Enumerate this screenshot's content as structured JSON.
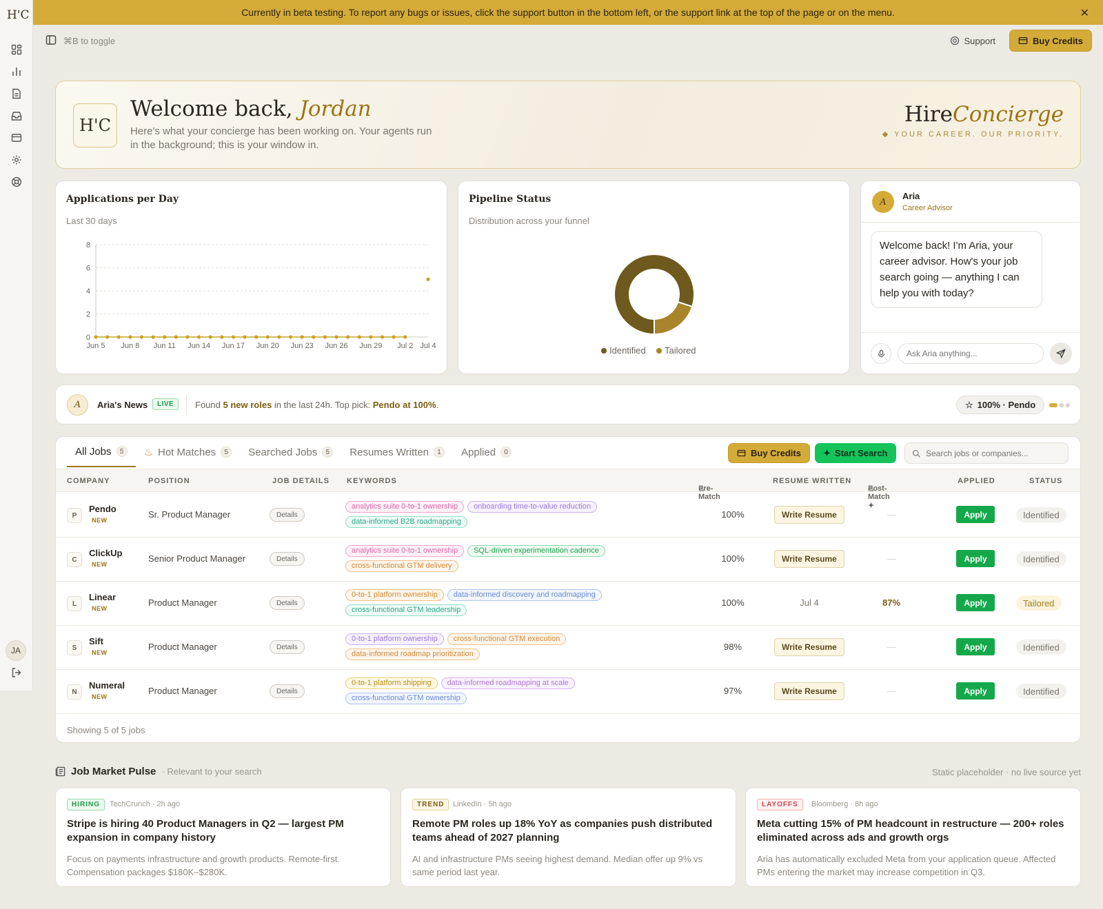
{
  "banner": {
    "text": "Currently in beta testing. To report any bugs or issues, click the support button in the bottom left, or the support link at the top of the page or on the menu."
  },
  "sidebar": {
    "logo": "H'C",
    "avatar": "JA"
  },
  "topbar": {
    "toggle_hint": "⌘B to toggle",
    "support": "Support",
    "buy_credits": "Buy Credits"
  },
  "hero": {
    "monogram": "H'C",
    "greeting": "Welcome back,",
    "name": "Jordan",
    "subtitle": "Here's what your concierge has been working on. Your agents run in the background; this is your window in.",
    "brand_a": "Hire",
    "brand_b": "Concierge",
    "tagline": "◆ YOUR CAREER. OUR PRIORITY."
  },
  "apps_chart": {
    "title": "Applications per Day",
    "subtitle": "Last 30 days",
    "chart_data": {
      "type": "line",
      "x": [
        "Jun 5",
        "Jun 6",
        "Jun 7",
        "Jun 8",
        "Jun 9",
        "Jun 10",
        "Jun 11",
        "Jun 12",
        "Jun 13",
        "Jun 14",
        "Jun 15",
        "Jun 16",
        "Jun 17",
        "Jun 18",
        "Jun 19",
        "Jun 20",
        "Jun 21",
        "Jun 22",
        "Jun 23",
        "Jun 24",
        "Jun 25",
        "Jun 26",
        "Jun 27",
        "Jun 28",
        "Jun 29",
        "Jun 30",
        "Jul 1",
        "Jul 2",
        "Jul 3",
        "Jul 4"
      ],
      "values": [
        0,
        0,
        0,
        0,
        0,
        0,
        0,
        0,
        0,
        0,
        0,
        0,
        0,
        0,
        0,
        0,
        0,
        0,
        0,
        0,
        0,
        0,
        0,
        0,
        0,
        0,
        0,
        0,
        null,
        5
      ],
      "xticks": [
        "Jun 5",
        "Jun 8",
        "Jun 11",
        "Jun 14",
        "Jun 17",
        "Jun 20",
        "Jun 23",
        "Jun 26",
        "Jun 29",
        "Jul 2",
        "Jul 4"
      ],
      "yticks": [
        0,
        2,
        4,
        6,
        8
      ],
      "ylim": [
        0,
        8
      ],
      "grid": true,
      "color": "#c9a227"
    }
  },
  "pipeline": {
    "title": "Pipeline Status",
    "subtitle": "Distribution across your funnel",
    "chart_data": {
      "type": "pie",
      "labels": [
        "Identified",
        "Tailored"
      ],
      "values": [
        4,
        1
      ],
      "colors": [
        "#6e5a1e",
        "#a8852a"
      ],
      "legend": "bottom"
    }
  },
  "aria": {
    "initial": "A",
    "name": "Aria",
    "role": "Career Advisor",
    "message": "Welcome back! I'm Aria, your career advisor. How's your job search going — anything I can help you with today?",
    "input_placeholder": "Ask Aria anything..."
  },
  "news": {
    "initial": "A",
    "label": "Aria's News",
    "live": "LIVE",
    "pre": "Found ",
    "count": "5 new roles",
    "mid": " in the last 24h. Top pick: ",
    "pick": "Pendo at 100%",
    "post": ".",
    "chip": "100% · Pendo"
  },
  "jobs": {
    "tabs": [
      {
        "label": "All Jobs",
        "count": "5"
      },
      {
        "label": "Hot Matches",
        "count": "5"
      },
      {
        "label": "Searched Jobs",
        "count": "5"
      },
      {
        "label": "Resumes Written",
        "count": "1"
      },
      {
        "label": "Applied",
        "count": "0"
      }
    ],
    "buy_credits": "Buy Credits",
    "start_search": "Start Search",
    "search_placeholder": "Search jobs or companies...",
    "headers": {
      "company": "COMPANY",
      "position": "POSITION",
      "details": "JOB DETAILS",
      "keywords": "KEYWORDS",
      "pre": "Pre-Match",
      "resume": "RESUME WRITTEN",
      "post": "Post-Match ✦",
      "applied": "APPLIED",
      "status": "STATUS"
    },
    "details_label": "Details",
    "new_label": "NEW",
    "write_label": "Write Resume",
    "apply_label": "Apply",
    "rows": [
      {
        "initial": "P",
        "company": "Pendo",
        "position": "Sr. Product Manager",
        "keywords": [
          {
            "t": "analytics suite 0-to-1 ownership",
            "c": "pink"
          },
          {
            "t": "onboarding time-to-value reduction",
            "c": "purple"
          },
          {
            "t": "data-informed B2B roadmapping",
            "c": "teal"
          }
        ],
        "pre": "100%",
        "resume": "",
        "post": "—",
        "status": "Identified"
      },
      {
        "initial": "C",
        "company": "ClickUp",
        "position": "Senior Product Manager",
        "keywords": [
          {
            "t": "analytics suite 0-to-1 ownership",
            "c": "pink"
          },
          {
            "t": "SQL-driven experimentation cadence",
            "c": "green"
          },
          {
            "t": "cross-functional GTM delivery",
            "c": "orange"
          }
        ],
        "pre": "100%",
        "resume": "",
        "post": "—",
        "status": "Identified"
      },
      {
        "initial": "L",
        "company": "Linear",
        "position": "Product Manager",
        "keywords": [
          {
            "t": "0-to-1 platform ownership",
            "c": "orange"
          },
          {
            "t": "data-informed discovery and roadmapping",
            "c": "blue"
          },
          {
            "t": "cross-functional GTM leadership",
            "c": "teal"
          }
        ],
        "pre": "100%",
        "resume": "Jul 4",
        "post": "87%",
        "status": "Tailored"
      },
      {
        "initial": "S",
        "company": "Sift",
        "position": "Product Manager",
        "keywords": [
          {
            "t": "0-to-1 platform ownership",
            "c": "purple"
          },
          {
            "t": "cross-functional GTM execution",
            "c": "orange"
          },
          {
            "t": "data-informed roadmap prioritization",
            "c": "orange"
          }
        ],
        "pre": "98%",
        "resume": "",
        "post": "—",
        "status": "Identified"
      },
      {
        "initial": "N",
        "company": "Numeral",
        "position": "Product Manager",
        "keywords": [
          {
            "t": "0-to-1 platform shipping",
            "c": "yellow"
          },
          {
            "t": "data-informed roadmapping at scale",
            "c": "violet"
          },
          {
            "t": "cross-functional GTM ownership",
            "c": "blue"
          }
        ],
        "pre": "97%",
        "resume": "",
        "post": "—",
        "status": "Identified"
      }
    ],
    "showing": "Showing 5 of 5 jobs"
  },
  "pulse": {
    "title": "Job Market Pulse",
    "subtitle": "· Relevant to your search",
    "note": "Static placeholder · no live source yet",
    "cards": [
      {
        "badge": "HIRING",
        "source": "TechCrunch · 2h ago",
        "headline": "Stripe is hiring 40 Product Managers in Q2 — largest PM expansion in company history",
        "body": "Focus on payments infrastructure and growth products. Remote-first. Compensation packages $180K–$280K."
      },
      {
        "badge": "TREND",
        "source": "LinkedIn · 5h ago",
        "headline": "Remote PM roles up 18% YoY as companies push distributed teams ahead of 2027 planning",
        "body": "AI and infrastructure PMs seeing highest demand. Median offer up 9% vs same period last year."
      },
      {
        "badge": "LAYOFFS",
        "source": "Bloomberg · 8h ago",
        "headline": "Meta cutting 15% of PM headcount in restructure — 200+ roles eliminated across ads and growth orgs",
        "body": "Aria has automatically excluded Meta from your application queue. Affected PMs entering the market may increase competition in Q3."
      }
    ]
  }
}
